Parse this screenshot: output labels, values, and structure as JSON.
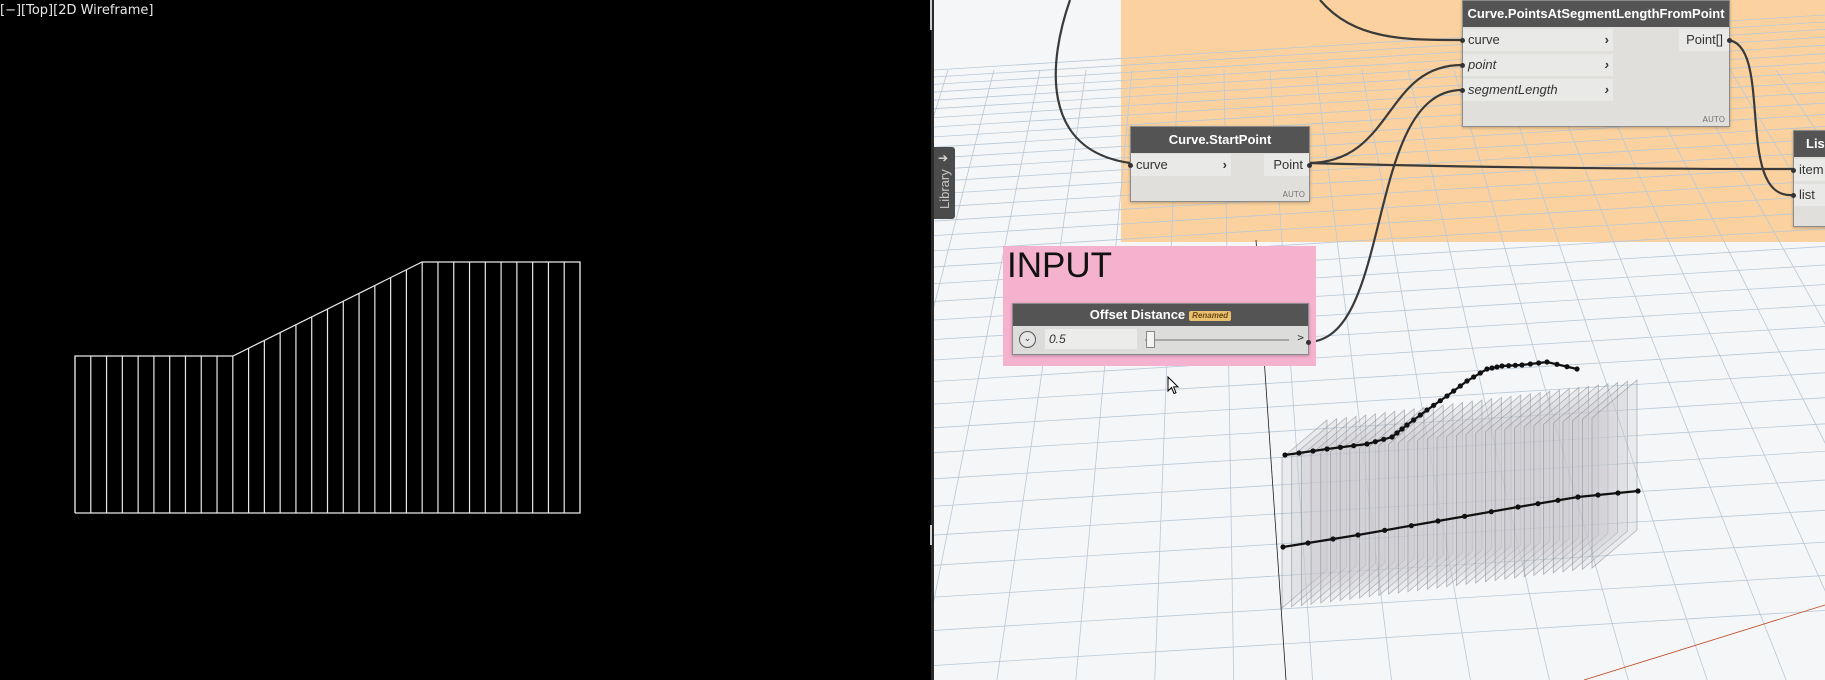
{
  "cad_viewport": {
    "label": "[−][Top][2D Wireframe]"
  },
  "workspace": {
    "library_tab": {
      "label": "Library",
      "icon": "arrow-right-icon"
    },
    "group_input": {
      "title": "INPUT",
      "color": "#f5b2cf"
    },
    "group_main": {
      "color": "#fbd29f"
    },
    "nodes": {
      "start_point": {
        "title": "Curve.StartPoint",
        "inputs": [
          "curve"
        ],
        "outputs": [
          "Point"
        ],
        "lacing": "AUTO"
      },
      "points_at_segment": {
        "title": "Curve.PointsAtSegmentLengthFromPoint",
        "inputs": [
          "curve",
          "point",
          "segmentLength"
        ],
        "outputs": [
          "Point[]"
        ],
        "lacing": "AUTO"
      },
      "list_node": {
        "title": "Lis",
        "inputs": [
          "item",
          "list"
        ]
      },
      "offset_slider": {
        "title": "Offset Distance",
        "badge": "Renamed",
        "value": "0.5",
        "more_label": ">"
      }
    }
  }
}
